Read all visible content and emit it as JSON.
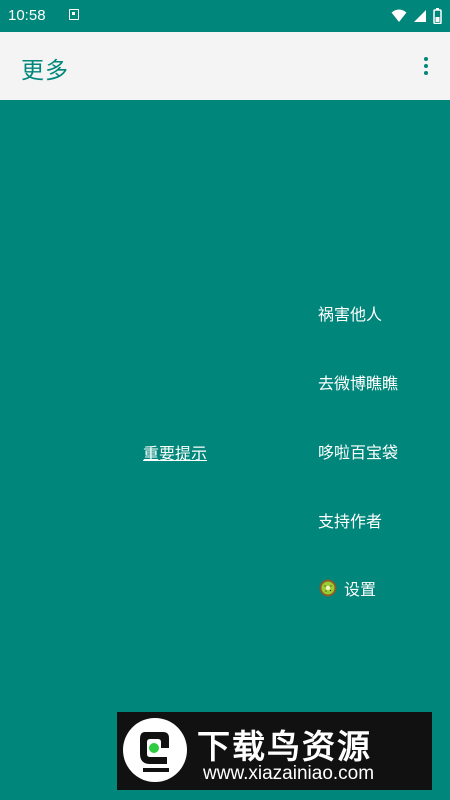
{
  "status_bar": {
    "time": "10:58",
    "icons": [
      "notification-icon",
      "wifi-icon",
      "signal-icon",
      "battery-icon"
    ]
  },
  "app_bar": {
    "title": "更多",
    "overflow_icon": "more-vert-icon"
  },
  "main": {
    "notice_link": "重要提示",
    "menu_items": [
      {
        "label": "祸害他人"
      },
      {
        "label": "去微博瞧瞧"
      },
      {
        "label": "哆啦百宝袋"
      },
      {
        "label": "支持作者"
      },
      {
        "label": "设置",
        "icon": "kiwi-icon"
      }
    ]
  },
  "watermark": {
    "title": "下载鸟资源",
    "url": "www.xiazainiao.com"
  },
  "colors": {
    "primary": "#00867a",
    "app_bar_bg": "#f4f4f4",
    "text_on_primary": "#ffffff"
  }
}
